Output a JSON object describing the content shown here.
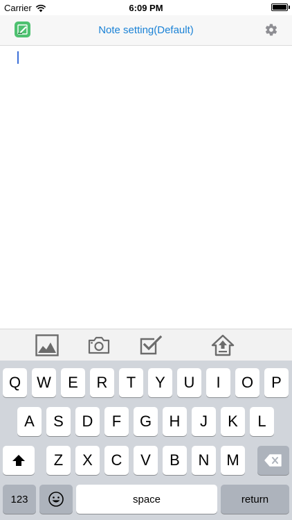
{
  "status_bar": {
    "carrier": "Carrier",
    "time": "6:09 PM",
    "battery_level": 1.0
  },
  "nav": {
    "title": "Note setting(Default)",
    "app_icon": "note-pen-icon",
    "settings_icon": "gear-icon"
  },
  "editor": {
    "text": ""
  },
  "toolbar": {
    "items": [
      {
        "name": "image-icon"
      },
      {
        "name": "camera-icon"
      },
      {
        "name": "checkbox-icon"
      },
      {
        "name": "home-upload-icon"
      }
    ]
  },
  "keyboard": {
    "row1": [
      "Q",
      "W",
      "E",
      "R",
      "T",
      "Y",
      "U",
      "I",
      "O",
      "P"
    ],
    "row2": [
      "A",
      "S",
      "D",
      "F",
      "G",
      "H",
      "J",
      "K",
      "L"
    ],
    "row3": [
      "Z",
      "X",
      "C",
      "V",
      "B",
      "N",
      "M"
    ],
    "numbers_label": "123",
    "space_label": "space",
    "return_label": "return"
  },
  "colors": {
    "accent": "#1a82d6",
    "app_icon_green": "#4ec170",
    "icon_gray": "#6b6b6b",
    "keyboard_bg": "#d1d5db"
  }
}
